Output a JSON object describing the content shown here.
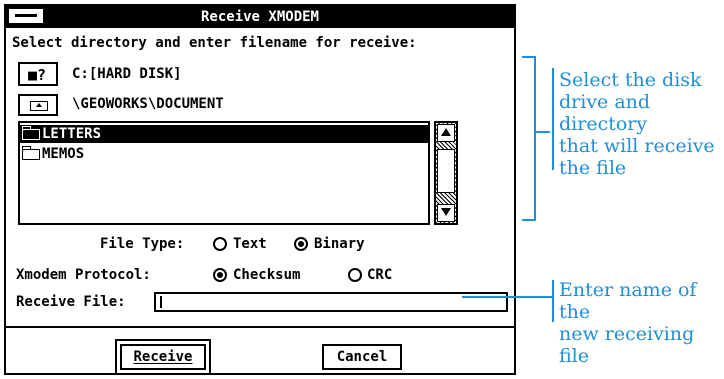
{
  "dialog": {
    "title": "Receive XMODEM",
    "instruction": "Select directory and enter filename for receive:",
    "drive_button": "■?",
    "drive_label": "C:[HARD DISK]",
    "path_label": "\\GEOWORKS\\DOCUMENT",
    "folders": [
      {
        "name": "LETTERS",
        "selected": true
      },
      {
        "name": "MEMOS",
        "selected": false
      }
    ],
    "file_type": {
      "label": "File Type:",
      "options": [
        {
          "label": "Text",
          "selected": false
        },
        {
          "label": "Binary",
          "selected": true
        }
      ]
    },
    "protocol": {
      "label": "Xmodem Protocol:",
      "options": [
        {
          "label": "Checksum",
          "selected": true
        },
        {
          "label": "CRC",
          "selected": false
        }
      ]
    },
    "receive_file": {
      "label": "Receive File:",
      "value": ""
    },
    "buttons": {
      "receive": "Receive",
      "cancel": "Cancel"
    }
  },
  "annotations": {
    "directory_note": [
      "Select the disk",
      "drive and directory",
      "that will receive",
      "the file"
    ],
    "file_note": [
      "Enter name of the",
      "new receiving file"
    ],
    "color": "#1f8fd6"
  }
}
